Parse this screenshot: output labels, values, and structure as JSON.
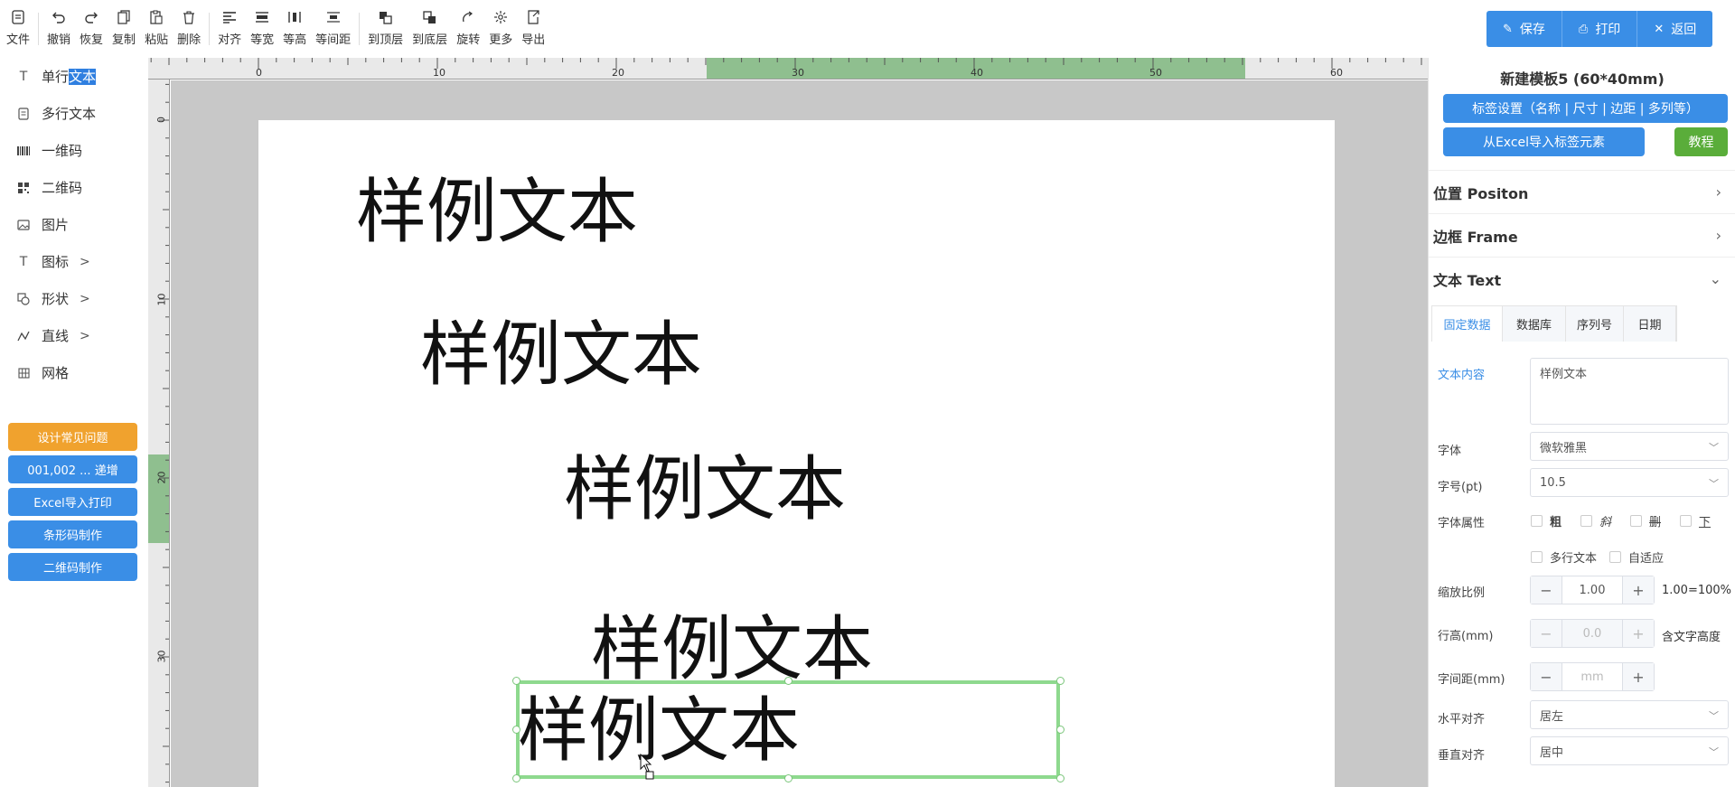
{
  "toolbar": {
    "items": [
      {
        "label": "文件",
        "icon": "file-icon"
      },
      {
        "label": "撤销",
        "icon": "undo-icon"
      },
      {
        "label": "恢复",
        "icon": "redo-icon"
      },
      {
        "label": "复制",
        "icon": "copy-icon"
      },
      {
        "label": "粘贴",
        "icon": "paste-icon"
      },
      {
        "label": "删除",
        "icon": "trash-icon"
      },
      {
        "label": "对齐",
        "icon": "align-icon"
      },
      {
        "label": "等宽",
        "icon": "equal-width-icon"
      },
      {
        "label": "等高",
        "icon": "equal-height-icon"
      },
      {
        "label": "等间距",
        "icon": "equal-spacing-icon"
      },
      {
        "label": "到顶层",
        "icon": "bring-front-icon"
      },
      {
        "label": "到底层",
        "icon": "send-back-icon"
      },
      {
        "label": "旋转",
        "icon": "rotate-icon"
      },
      {
        "label": "更多",
        "icon": "more-icon"
      },
      {
        "label": "导出",
        "icon": "export-icon"
      }
    ]
  },
  "header": {
    "save": "保存",
    "print": "打印",
    "back": "返回"
  },
  "sidebar": {
    "items": [
      {
        "label_a": "单行",
        "label_b": "文本",
        "icon": "text-icon"
      },
      {
        "label": "多行文本",
        "icon": "multiline-text-icon"
      },
      {
        "label": "一维码",
        "icon": "barcode-icon"
      },
      {
        "label": "二维码",
        "icon": "qrcode-icon"
      },
      {
        "label": "图片",
        "icon": "image-icon"
      },
      {
        "label": "图标",
        "icon": "text-icon"
      },
      {
        "label": "形状",
        "icon": "shape-icon"
      },
      {
        "label": "直线",
        "icon": "line-icon"
      },
      {
        "label": "网格",
        "icon": "grid-icon"
      }
    ],
    "buttons": [
      {
        "label": "设计常见问题",
        "color": "#f0a22e"
      },
      {
        "label": "001,002 ... 递增",
        "color": "#3a8ee6"
      },
      {
        "label": "Excel导入打印",
        "color": "#3a8ee6"
      },
      {
        "label": "条形码制作",
        "color": "#3a8ee6"
      },
      {
        "label": "二维码制作",
        "color": "#3a8ee6"
      }
    ]
  },
  "ruler": {
    "h_labels": [
      "0",
      "10",
      "20",
      "30",
      "40",
      "50",
      "60"
    ],
    "v_labels": [
      "0",
      "10",
      "20",
      "30"
    ]
  },
  "canvas": {
    "texts": [
      "样例文本",
      "样例文本",
      "样例文本",
      "样例文本",
      "样例文本"
    ]
  },
  "panel": {
    "title": "新建模板5 (60*40mm)",
    "label_settings": "标签设置（名称 | 尺寸 | 边距 | 多列等）",
    "excel_import": "从Excel导入标签元素",
    "tutorial": "教程",
    "sections": {
      "position": "位置 Positon",
      "frame": "边框 Frame",
      "text": "文本 Text"
    },
    "tabs": [
      "固定数据",
      "数据库",
      "序列号",
      "日期"
    ],
    "fields": {
      "content_label": "文本内容",
      "content_value": "样例文本",
      "font_label": "字体",
      "font_value": "微软雅黑",
      "size_label": "字号(pt)",
      "size_value": "10.5",
      "attr_label": "字体属性",
      "bold": "粗",
      "italic": "斜",
      "strike": "删",
      "underline": "下",
      "multiline": "多行文本",
      "autofit": "自适应",
      "scale_label": "缩放比例",
      "scale_value": "1.00",
      "scale_suffix": "1.00=100%",
      "lineheight_label": "行高(mm)",
      "lineheight_value": "0.0",
      "lineheight_suffix": "含文字高度",
      "spacing_label": "字间距(mm)",
      "spacing_placeholder": "mm",
      "halign_label": "水平对齐",
      "halign_value": "居左",
      "valign_label": "垂直对齐",
      "valign_value": "居中"
    }
  },
  "colors": {
    "primary": "#3a8ee6",
    "warning": "#f0a22e",
    "success": "#5aad3a",
    "selection": "#8ed98e",
    "ruler_highlight": "#8fbf8f"
  }
}
